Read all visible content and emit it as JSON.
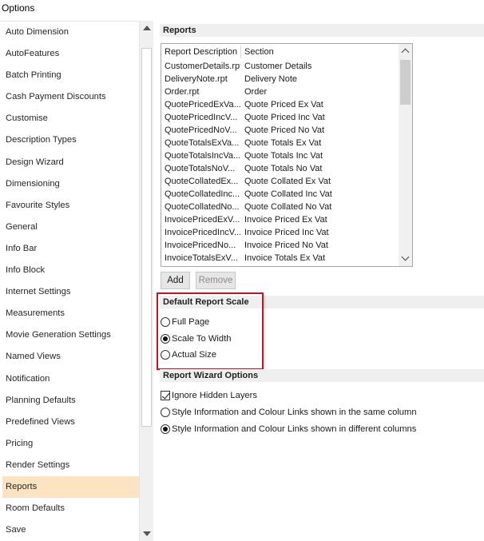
{
  "window": {
    "title": "Options"
  },
  "nav": {
    "items": [
      "Auto Dimension",
      "AutoFeatures",
      "Batch Printing",
      "Cash Payment Discounts",
      "Customise",
      "Description Types",
      "Design Wizard",
      "Dimensioning",
      "Favourite Styles",
      "General",
      "Info Bar",
      "Info Block",
      "Internet Settings",
      "Measurements",
      "Movie Generation Settings",
      "Named Views",
      "Notification",
      "Planning Defaults",
      "Predefined Views",
      "Pricing",
      "Render Settings",
      "Reports",
      "Room Defaults",
      "Save"
    ],
    "selected": "Reports",
    "selection_color": "#fce3c2"
  },
  "reports": {
    "header": "Reports",
    "columns": [
      "Report Description",
      "Section"
    ],
    "rows": [
      [
        "CustomerDetails.rpt",
        "Customer Details"
      ],
      [
        "DeliveryNote.rpt",
        "Delivery Note"
      ],
      [
        "Order.rpt",
        "Order"
      ],
      [
        "QuotePricedExVa...",
        "Quote Priced Ex Vat"
      ],
      [
        "QuotePricedIncV...",
        "Quote Priced Inc Vat"
      ],
      [
        "QuotePricedNoV...",
        "Quote Priced No Vat"
      ],
      [
        "QuoteTotalsExVa...",
        "Quote Totals Ex Vat"
      ],
      [
        "QuoteTotalsIncVa...",
        "Quote Totals Inc Vat"
      ],
      [
        "QuoteTotalsNoV...",
        "Quote Totals No Vat"
      ],
      [
        "QuoteCollatedEx...",
        "Quote Collated Ex Vat"
      ],
      [
        "QuoteCollatedInc...",
        "Quote Collated Inc Vat"
      ],
      [
        "QuoteCollatedNo...",
        "Quote Collated No Vat"
      ],
      [
        "InvoicePricedExV...",
        "Invoice Priced Ex Vat"
      ],
      [
        "InvoicePricedIncV...",
        "Invoice Priced Inc Vat"
      ],
      [
        "InvoicePricedNo...",
        "Invoice Priced No Vat"
      ],
      [
        "InvoiceTotalsExV...",
        "Invoice Totals Ex Vat"
      ]
    ],
    "add_label": "Add",
    "remove_label": "Remove"
  },
  "scale": {
    "header": "Default Report Scale",
    "options": [
      "Full Page",
      "Scale To Width",
      "Actual Size"
    ],
    "selected": "Scale To Width",
    "highlight_color": "#b01c2e"
  },
  "wizard": {
    "header": "Report Wizard Options",
    "ignore_hidden_layers_label": "Ignore Hidden Layers",
    "ignore_hidden_layers_checked": true,
    "column_options": [
      "Style Information and Colour Links shown in the same column",
      "Style Information and Colour Links shown in different columns"
    ],
    "column_selected": "Style Information and Colour Links shown in different columns"
  },
  "icons": {
    "nav_scroll_up": "triangle-up-icon",
    "nav_scroll_down": "triangle-down-icon",
    "list_scroll_up": "chevron-up-icon",
    "list_scroll_down": "chevron-down-icon"
  }
}
